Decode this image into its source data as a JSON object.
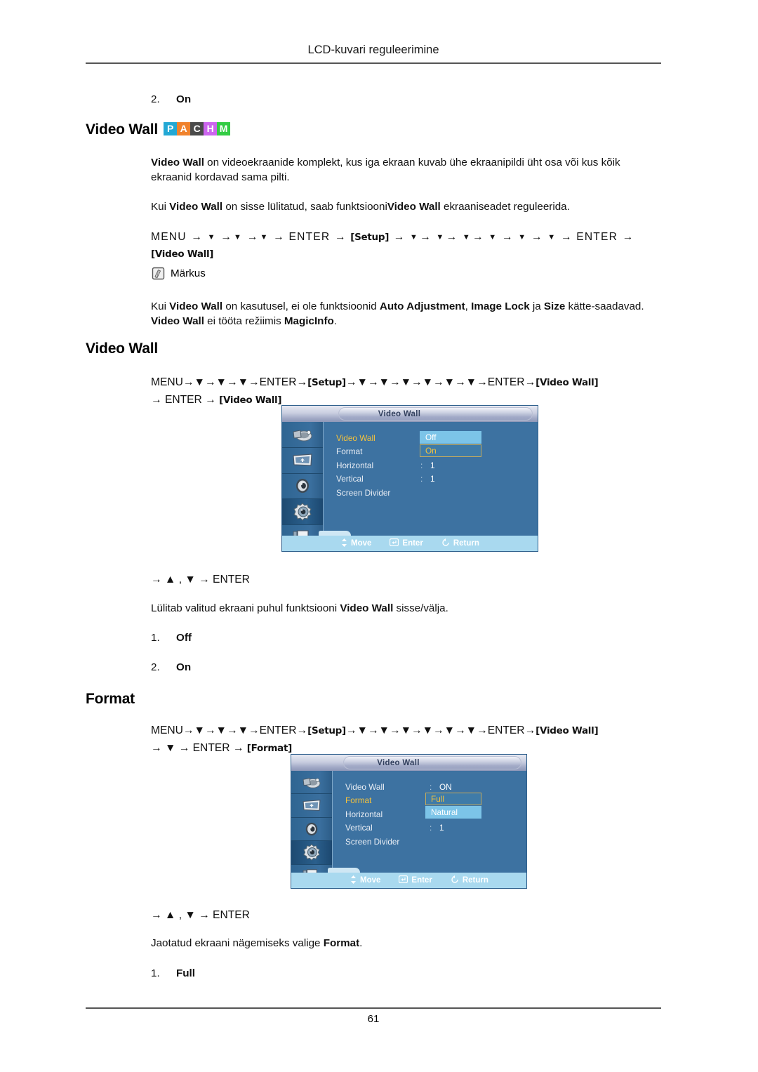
{
  "header": {
    "title": "LCD-kuvari reguleerimine"
  },
  "footer": {
    "page_number": "61"
  },
  "top_list": {
    "number": "2.",
    "value": "On"
  },
  "section_video_wall_intro": {
    "heading": "Video Wall",
    "badges": [
      {
        "letter": "P",
        "color": "#23a8d4"
      },
      {
        "letter": "A",
        "color": "#f0822c"
      },
      {
        "letter": "C",
        "color": "#4a4a4a"
      },
      {
        "letter": "H",
        "color": "#cc66ee"
      },
      {
        "letter": "M",
        "color": "#33cc44"
      }
    ],
    "paragraph1_bold": "Video Wall",
    "paragraph1_rest": " on videoekraanide komplekt, kus iga ekraan kuvab ühe ekraanipildi üht osa või kus kõik ekraanid kordavad sama pilti.",
    "paragraph2_a": "Kui ",
    "paragraph2_b1": "Video Wall",
    "paragraph2_c": " on sisse lülitatud, saab funktsiooni",
    "paragraph2_b2": "Video Wall",
    "paragraph2_d": " ekraaniseadet reguleerida."
  },
  "menu_path_intro": {
    "menu": "MENU",
    "enter": "ENTER",
    "tag_setup": "Setup",
    "tag_video_wall": "Video Wall",
    "down_arrow": "▼",
    "up_arrow": "▲",
    "right_arrow": "→"
  },
  "note": {
    "label": "Märkus",
    "icon": "note-pencil-icon",
    "text_a": "Kui ",
    "text_b1": "Video Wall",
    "text_c": " on kasutusel, ei ole funktsioonid ",
    "text_b2": "Auto Adjustment",
    "text_d": ", ",
    "text_b3": "Image Lock",
    "text_e": " ja ",
    "text_b4": "Size",
    "text_f": " kätte-saadavad. ",
    "text_b5": "Video Wall",
    "text_g": " ei tööta režiimis ",
    "text_b6": "MagicInfo",
    "text_h": "."
  },
  "section_video_wall": {
    "heading": "Video Wall",
    "keys_line": "→ ▲ , ▼ → ENTER",
    "description_a": "Lülitab valitud ekraani puhul funktsiooni ",
    "description_b": "Video Wall",
    "description_c": " sisse/välja.",
    "options": [
      {
        "number": "1.",
        "value": "Off"
      },
      {
        "number": "2.",
        "value": "On"
      }
    ],
    "osd": {
      "title": "Video Wall",
      "rows": [
        {
          "label": "Video Wall",
          "selected": true,
          "colon": ":",
          "value": ""
        },
        {
          "label": "Format",
          "selected": false,
          "colon": ":",
          "value": ""
        },
        {
          "label": "Horizontal",
          "selected": false,
          "colon": ":",
          "value": "1"
        },
        {
          "label": "Vertical",
          "selected": false,
          "colon": ":",
          "value": "1"
        },
        {
          "label": "Screen Divider",
          "selected": false,
          "colon": "",
          "value": ""
        }
      ],
      "dropdown": [
        {
          "text": "Off",
          "style": "light"
        },
        {
          "text": "On",
          "style": "active"
        }
      ],
      "sidebar_icons": [
        "picture-icon",
        "screen-icon",
        "sound-icon",
        "setup-gear-icon",
        "multi-control-icon"
      ],
      "footer": [
        {
          "icon": "updown-arrow-icon",
          "label": "Move"
        },
        {
          "icon": "enter-key-icon",
          "label": "Enter"
        },
        {
          "icon": "return-arrow-icon",
          "label": "Return"
        }
      ]
    }
  },
  "section_format": {
    "heading": "Format",
    "keys_line": "→ ▲ , ▼ → ENTER",
    "description_a": "Jaotatud ekraani nägemiseks valige ",
    "description_b": "Format",
    "description_c": ".",
    "options": [
      {
        "number": "1.",
        "value": "Full"
      }
    ],
    "tag_format": "Format",
    "osd": {
      "title": "Video Wall",
      "rows": [
        {
          "label": "Video Wall",
          "selected": false,
          "colon": ":",
          "value": "ON"
        },
        {
          "label": "Format",
          "selected": true,
          "colon": ":",
          "value": ""
        },
        {
          "label": "Horizontal",
          "selected": false,
          "colon": ":",
          "value": ""
        },
        {
          "label": "Vertical",
          "selected": false,
          "colon": ":",
          "value": "1"
        },
        {
          "label": "Screen Divider",
          "selected": false,
          "colon": "",
          "value": ""
        }
      ],
      "dropdown": [
        {
          "text": "Full",
          "style": "active"
        },
        {
          "text": "Natural",
          "style": "light"
        }
      ],
      "sidebar_icons": [
        "picture-icon",
        "screen-icon",
        "sound-icon",
        "setup-gear-icon",
        "multi-control-icon"
      ],
      "footer": [
        {
          "icon": "updown-arrow-icon",
          "label": "Move"
        },
        {
          "icon": "enter-key-icon",
          "label": "Enter"
        },
        {
          "icon": "return-arrow-icon",
          "label": "Return"
        }
      ]
    }
  },
  "colors": {
    "osd_body": "#3d72a1",
    "osd_footer": "#a9d9ef",
    "osd_highlight_light": "#7cc4e8",
    "osd_selected_text": "#f5c23c"
  }
}
